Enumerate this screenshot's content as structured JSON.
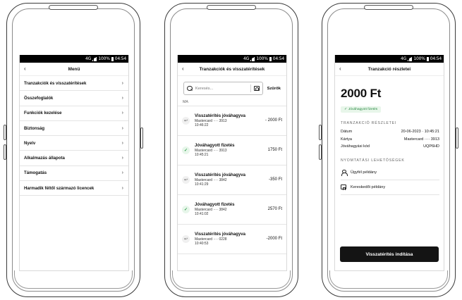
{
  "status_bar": {
    "network": "4G",
    "battery": "100%",
    "time": "04:54"
  },
  "menu_screen": {
    "title": "Menü",
    "back_icon": "chevron-left-icon",
    "items": [
      {
        "label": "Tranzakciók és visszatérítések"
      },
      {
        "label": "Összefoglalók"
      },
      {
        "label": "Funkciók kezelése"
      },
      {
        "label": "Biztonság"
      },
      {
        "label": "Nyelv"
      },
      {
        "label": "Alkalmazás állapota"
      },
      {
        "label": "Támogatás"
      },
      {
        "label": "Harmadik féltől származó licencek"
      }
    ]
  },
  "transactions_screen": {
    "title": "Tranzakciók és visszatérítések",
    "search_placeholder": "Keresés...",
    "filter_label": "Szűrők",
    "section_label": "MA",
    "transactions": [
      {
        "type": "refund",
        "title": "Visszatérítés jóváhagyva",
        "card": "Mastercard ···· 3913",
        "time": "10:46:22",
        "amount": "- 2000 Ft"
      },
      {
        "type": "approved",
        "title": "Jóváhagyott fizetés",
        "card": "Mastercard ···· 3913",
        "time": "10:45:21",
        "amount": "1750 Ft"
      },
      {
        "type": "refund",
        "title": "Visszatérítés jóváhagyva",
        "card": "Mastercard ···· 3842",
        "time": "10:41:29",
        "amount": "-350 Ft"
      },
      {
        "type": "approved",
        "title": "Jóváhagyott fizetés",
        "card": "Mastercard ···· 3842",
        "time": "10:41:02",
        "amount": "2570 Ft"
      },
      {
        "type": "refund",
        "title": "Visszatérítés jóváhagyva",
        "card": "Mastercard ···· 0228",
        "time": "10:40:53",
        "amount": "-2000 Ft"
      }
    ]
  },
  "detail_screen": {
    "title": "Tranzakció részletei",
    "amount": "2000 Ft",
    "status_badge": "Jóváhagyott fizetés",
    "details_heading": "TRANZAKCIÓ RÉSZLETEI",
    "details": [
      {
        "key": "Dátum",
        "value": "20-06-2023 · 10:45:21"
      },
      {
        "key": "Kártya",
        "value": "Mastercard ···· 3913"
      },
      {
        "key": "Jóváhagyási kód",
        "value": "UQP6HD"
      }
    ],
    "print_heading": "NYOMTATÁSI LEHETŐSÉGEK",
    "print_options": [
      {
        "label": "Ügyfél példány",
        "icon": "person-icon"
      },
      {
        "label": "Kereskedői példány",
        "icon": "store-icon"
      }
    ],
    "refund_button": "Visszatérítés indítása"
  },
  "colors": {
    "approved_green": "#2e9e4b",
    "cta_dark": "#141414"
  }
}
